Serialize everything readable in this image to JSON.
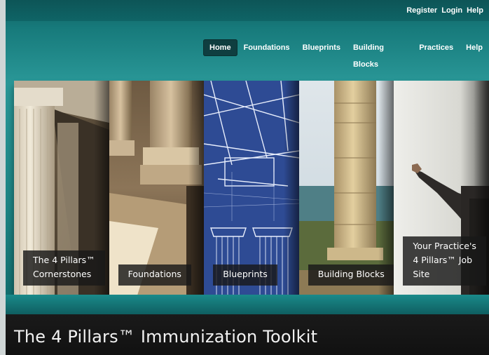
{
  "top_links": [
    "Register",
    "Login",
    "Help"
  ],
  "nav": {
    "items": [
      {
        "label": "Home",
        "active": true
      },
      {
        "label": "Foundations",
        "active": false
      },
      {
        "label": "Blueprints",
        "active": false
      },
      {
        "label": "Building Blocks",
        "active": false
      },
      {
        "label": "Practices",
        "active": false
      },
      {
        "label": "Help",
        "active": false
      }
    ]
  },
  "panels": [
    {
      "lines": [
        "The 4 Pillars™",
        "Cornerstones"
      ],
      "image": "classical-columns-photo"
    },
    {
      "lines": [
        "Foundations"
      ],
      "image": "column-bases-photo"
    },
    {
      "lines": [
        "Blueprints"
      ],
      "image": "blueprint-drawing"
    },
    {
      "lines": [
        "Building Blocks"
      ],
      "image": "stone-column-sea-photo"
    },
    {
      "lines": [
        "Your Practice's",
        "4 Pillars™ Job",
        "Site"
      ],
      "image": "pointing-man-photo"
    }
  ],
  "page_title": "The 4 Pillars™ Immunization Toolkit",
  "colors": {
    "teal": "#1d8585",
    "dark_teal": "#0f5f61",
    "nav_active": "#0f3e40",
    "title_bar": "#151515"
  }
}
